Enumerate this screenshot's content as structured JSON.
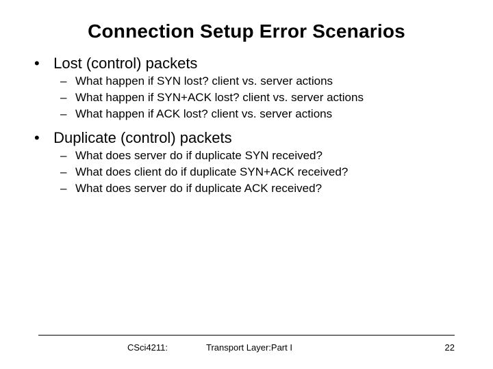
{
  "title": "Connection Setup Error Scenarios",
  "bullets": [
    {
      "label": "Lost (control) packets",
      "sub": [
        "What happen if SYN lost?  client vs. server actions",
        "What happen if SYN+ACK lost? client vs. server actions",
        "What happen if ACK lost? client vs. server actions"
      ]
    },
    {
      "label": "Duplicate (control) packets",
      "sub": [
        "What does server do if duplicate SYN received?",
        "What does client do if duplicate SYN+ACK received?",
        "What does server do if duplicate ACK received?"
      ]
    }
  ],
  "footer": {
    "course": "CSci4211:",
    "topic": "Transport Layer:Part I",
    "page": "22"
  }
}
